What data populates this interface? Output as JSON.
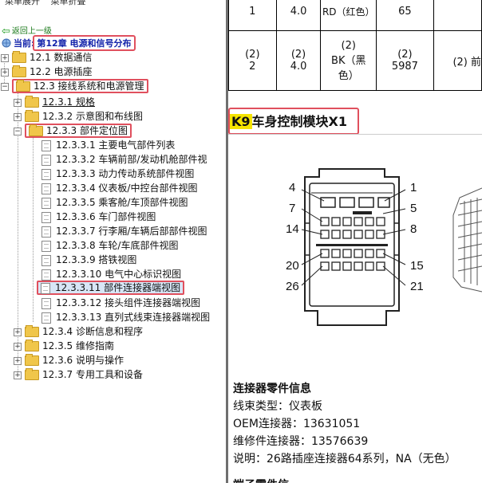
{
  "menu": {
    "expand": "菜单展开",
    "collapse": "菜单折叠"
  },
  "nav": {
    "back": "返回上一级",
    "current_prefix": "当前:",
    "current_title": "第12章 电源和信号分布"
  },
  "tree": {
    "n12_1": "12.1 数据通信",
    "n12_2": "12.2 电源插座",
    "n12_3": "12.3 接线系统和电源管理",
    "n12_3_1": "12.3.1 规格",
    "n12_3_2": "12.3.2 示意图和布线图",
    "n12_3_3": "12.3.3 部件定位图",
    "leaves": [
      "12.3.3.1 主要电气部件列表",
      "12.3.3.2 车辆前部/发动机舱部件视",
      "12.3.3.3 动力传动系统部件视图",
      "12.3.3.4 仪表板/中控台部件视图",
      "12.3.3.5 乘客舱/车顶部件视图",
      "12.3.3.6 车门部件视图",
      "12.3.3.7 行李厢/车辆后部部件视图",
      "12.3.3.8 车轮/车底部件视图",
      "12.3.3.9 搭铁视图",
      "12.3.3.10 电气中心标识视图",
      "12.3.3.11 部件连接器端视图",
      "12.3.3.12 接头组件连接器端视图",
      "12.3.3.13 直列式线束连接器端视图"
    ],
    "n12_3_4": "12.3.4 诊断信息和程序",
    "n12_3_5": "12.3.5 维修指南",
    "n12_3_6": "12.3.6 说明与操作",
    "n12_3_7": "12.3.7 专用工具和设备"
  },
  "table": {
    "row1": {
      "c1": "1",
      "c2": "4.0",
      "c3": "RD（红色）",
      "c4": "65"
    },
    "row2": {
      "c1a": "(2)",
      "c1b": "2",
      "c2a": "(2)",
      "c2b": "4.0",
      "c3a": "(2)",
      "c3b": "BK（黑",
      "c3c": "色）",
      "c4a": "(2)",
      "c4b": "5987",
      "c5": "(2) 前"
    }
  },
  "component": {
    "code": "K9",
    "title": "车身控制模块X1"
  },
  "pins": [
    "4",
    "1",
    "7",
    "5",
    "14",
    "8",
    "20",
    "15",
    "26",
    "21"
  ],
  "info": {
    "heading": "连接器零件信息",
    "harness": "线束类型：仪表板",
    "oem": "OEM连接器：13631051",
    "service": "维修件连接器：13576639",
    "desc": "说明：26路插座连接器64系列，NA（无色）",
    "next": "端子零件信"
  }
}
